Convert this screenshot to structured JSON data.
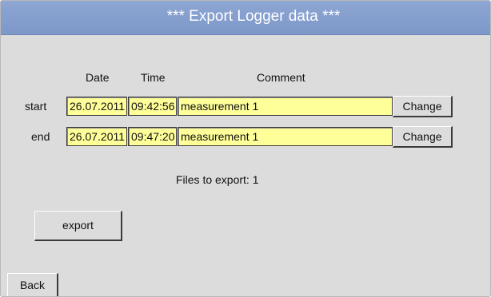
{
  "header": {
    "title": "***  Export Logger data  ***"
  },
  "columns": {
    "date": "Date",
    "time": "Time",
    "comment": "Comment"
  },
  "rows": [
    {
      "label": "start",
      "date": "26.07.2011",
      "time": "09:42:56",
      "comment": "measurement 1",
      "button": "Change"
    },
    {
      "label": "end",
      "date": "26.07.2011",
      "time": "09:47:20",
      "comment": "measurement 1",
      "button": "Change"
    }
  ],
  "status": {
    "files_to_export": "Files to export:  1"
  },
  "actions": {
    "export": "export",
    "back": "Back"
  },
  "colors": {
    "title_bar": "#8da6d3",
    "field_background": "#ffff9a",
    "panel_background": "#dcdcdc"
  }
}
